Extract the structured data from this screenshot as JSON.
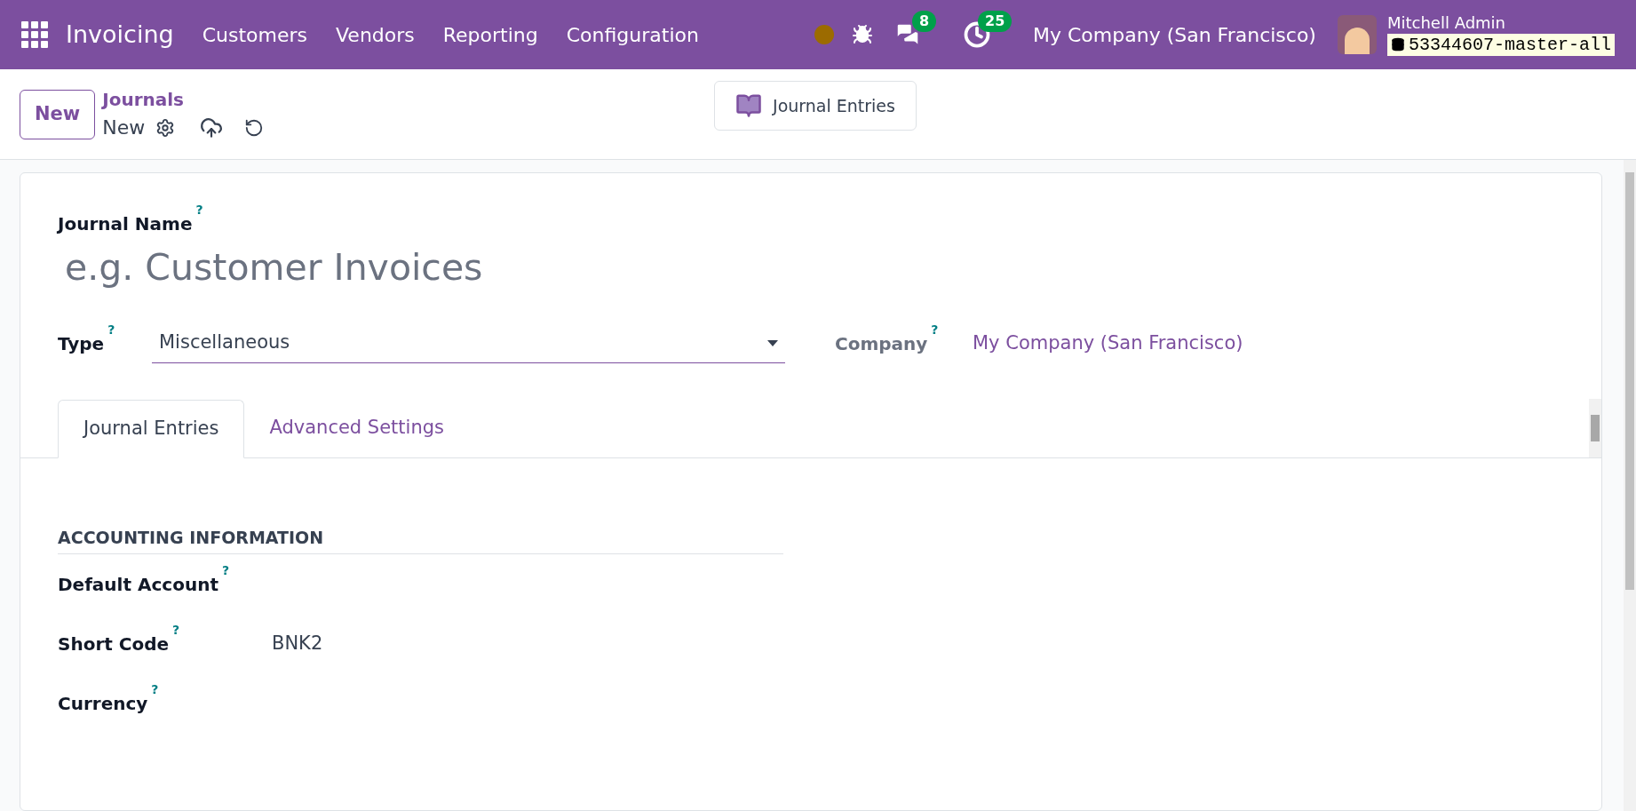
{
  "navbar": {
    "app_name": "Invoicing",
    "menu": [
      "Customers",
      "Vendors",
      "Reporting",
      "Configuration"
    ],
    "messages_count": "8",
    "activities_count": "25",
    "company": "My Company (San Francisco)",
    "user_name": "Mitchell Admin",
    "database": "53344607-master-all"
  },
  "control_panel": {
    "new_button": "New",
    "breadcrumb": "Journals",
    "record": "New",
    "smart_button": "Journal Entries"
  },
  "form": {
    "journal_name": {
      "label": "Journal Name",
      "help": "?",
      "placeholder": "e.g. Customer Invoices"
    },
    "type": {
      "label": "Type",
      "help": "?",
      "value": "Miscellaneous"
    },
    "company": {
      "label": "Company",
      "help": "?",
      "value": "My Company (San Francisco)"
    },
    "tabs": [
      {
        "label": "Journal Entries",
        "selected": true
      },
      {
        "label": "Advanced Settings",
        "selected": false
      }
    ],
    "section_title": "ACCOUNTING INFORMATION",
    "fields": [
      {
        "label": "Default Account",
        "help": "?"
      },
      {
        "label": "Short Code",
        "help": "?",
        "value": "BNK2"
      },
      {
        "label": "Currency",
        "help": "?"
      }
    ]
  }
}
